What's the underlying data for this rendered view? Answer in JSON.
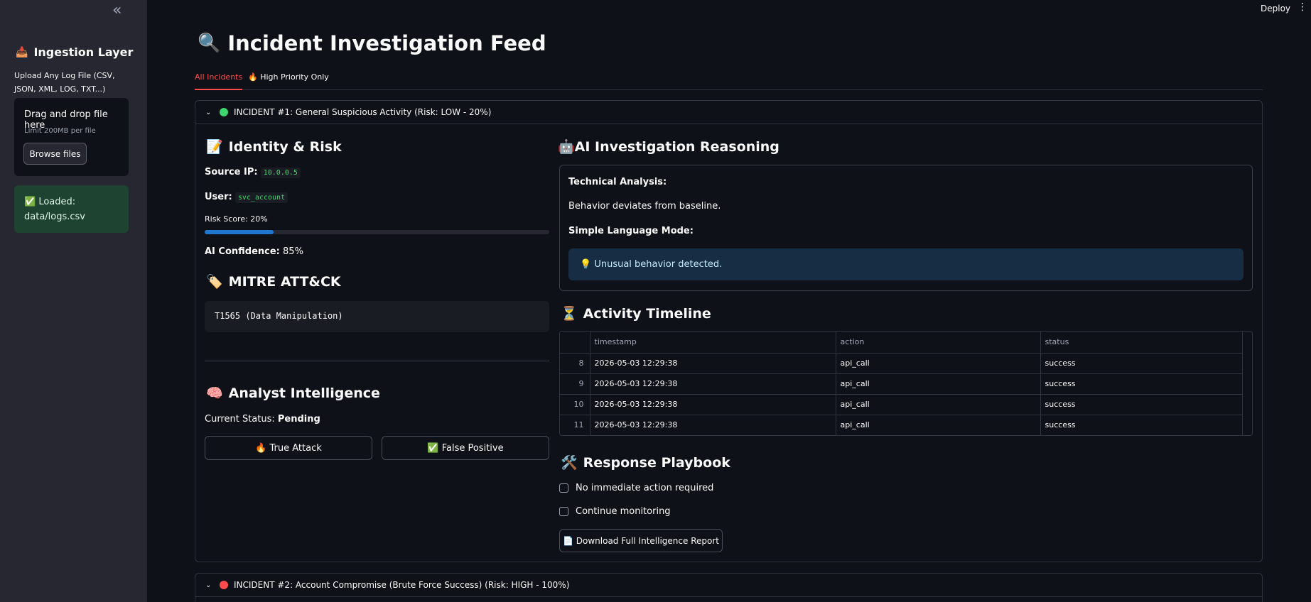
{
  "sidebar": {
    "collapse_icon": "«",
    "title": "Ingestion Layer",
    "title_icon": "inbox-tray-icon",
    "upload_label": "Upload Any Log File (CSV, JSON, XML, LOG, TXT...)",
    "dropzone_title": "Drag and drop file here",
    "dropzone_limit": "Limit 200MB per file",
    "browse_label": "Browse files",
    "loaded_line1": "✅ Loaded:",
    "loaded_line2": "data/logs.csv"
  },
  "topbar": {
    "deploy_label": "Deploy",
    "menu_icon": "⋮"
  },
  "page": {
    "title_icon": "🔍",
    "title": "Incident Investigation Feed",
    "tabs": [
      {
        "label": "All Incidents",
        "active": true
      },
      {
        "label": "🔥 High Priority Only",
        "active": false
      }
    ]
  },
  "incidents": [
    {
      "header": "INCIDENT #1: General Suspicious Activity (Risk: LOW - 20%)",
      "status_color": "#3dd56d",
      "identity": {
        "heading": "Identity & Risk",
        "heading_icon": "📝",
        "source_ip_label": "Source IP:",
        "source_ip": "10.0.0.5",
        "user_label": "User:",
        "user": "svc_account",
        "risk_label": "Risk Score: 20%",
        "risk_value": 20,
        "confidence_label": "AI Confidence:",
        "confidence": "85%"
      },
      "mitre": {
        "heading": "MITRE ATT&CK",
        "heading_icon": "🏷️",
        "technique": "T1565 (Data Manipulation)"
      },
      "analyst": {
        "heading": "Analyst Intelligence",
        "heading_icon": "🧠",
        "status_label": "Current Status:",
        "status": "Pending",
        "true_attack_label": "🔥 True Attack",
        "false_positive_label": "✅ False Positive"
      },
      "reasoning": {
        "heading": "🤖AI Investigation Reasoning",
        "technical_label": "Technical Analysis:",
        "technical_text": "Behavior deviates from baseline.",
        "simple_label": "Simple Language Mode:",
        "simple_text": "💡 Unusual behavior detected."
      },
      "timeline": {
        "heading": "Activity Timeline",
        "heading_icon": "⏳",
        "columns": [
          "",
          "timestamp",
          "action",
          "status"
        ],
        "rows": [
          [
            "8",
            "2026-05-03 12:29:38",
            "api_call",
            "success"
          ],
          [
            "9",
            "2026-05-03 12:29:38",
            "api_call",
            "success"
          ],
          [
            "10",
            "2026-05-03 12:29:38",
            "api_call",
            "success"
          ],
          [
            "11",
            "2026-05-03 12:29:38",
            "api_call",
            "success"
          ]
        ]
      },
      "playbook": {
        "heading": "Response Playbook",
        "heading_icon": "🛠️",
        "items": [
          "No immediate action required",
          "Continue monitoring"
        ],
        "download_label": "📄 Download Full Intelligence Report"
      }
    },
    {
      "header": "INCIDENT #2: Account Compromise (Brute Force Success) (Risk: HIGH - 100%)",
      "status_color": "#ff4b4b"
    }
  ]
}
